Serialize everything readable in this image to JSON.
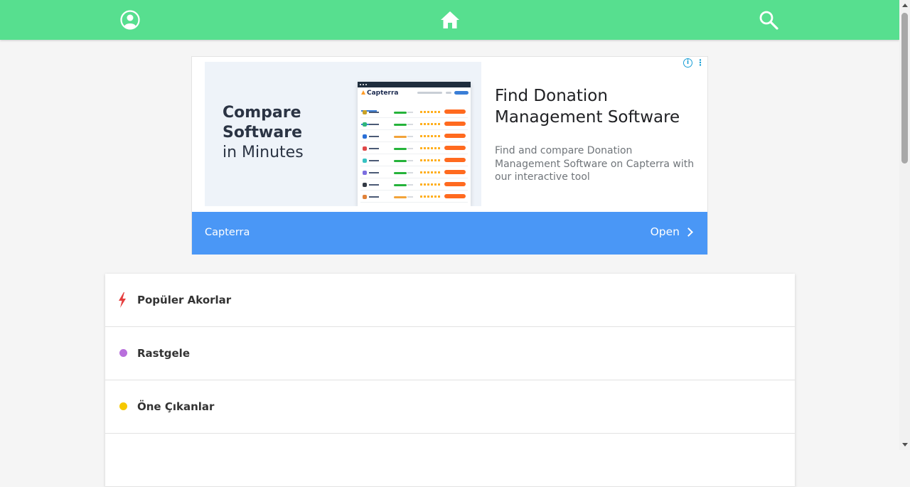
{
  "header": {
    "icons": [
      "user-circle-icon",
      "home-icon",
      "search-icon"
    ],
    "background_color": "#57df8f"
  },
  "ad": {
    "image_text": {
      "line1": "Compare",
      "line2": "Software",
      "line3": "in Minutes"
    },
    "mock_brand": "Capterra",
    "title": "Find Donation Management Software",
    "description": "Find and compare Donation Management Software on Capterra with our interactive tool",
    "brand": "Capterra",
    "cta": "Open",
    "info_icon": "i",
    "bar_color": "#4a97f6"
  },
  "list": {
    "items": [
      {
        "label": "Popüler Akorlar",
        "icon": "bolt-icon",
        "color": "#e53e3e"
      },
      {
        "label": "Rastgele",
        "icon": "dot-icon",
        "color": "#b86fdc"
      },
      {
        "label": "Öne Çıkanlar",
        "icon": "dot-icon",
        "color": "#f6c800"
      }
    ]
  }
}
